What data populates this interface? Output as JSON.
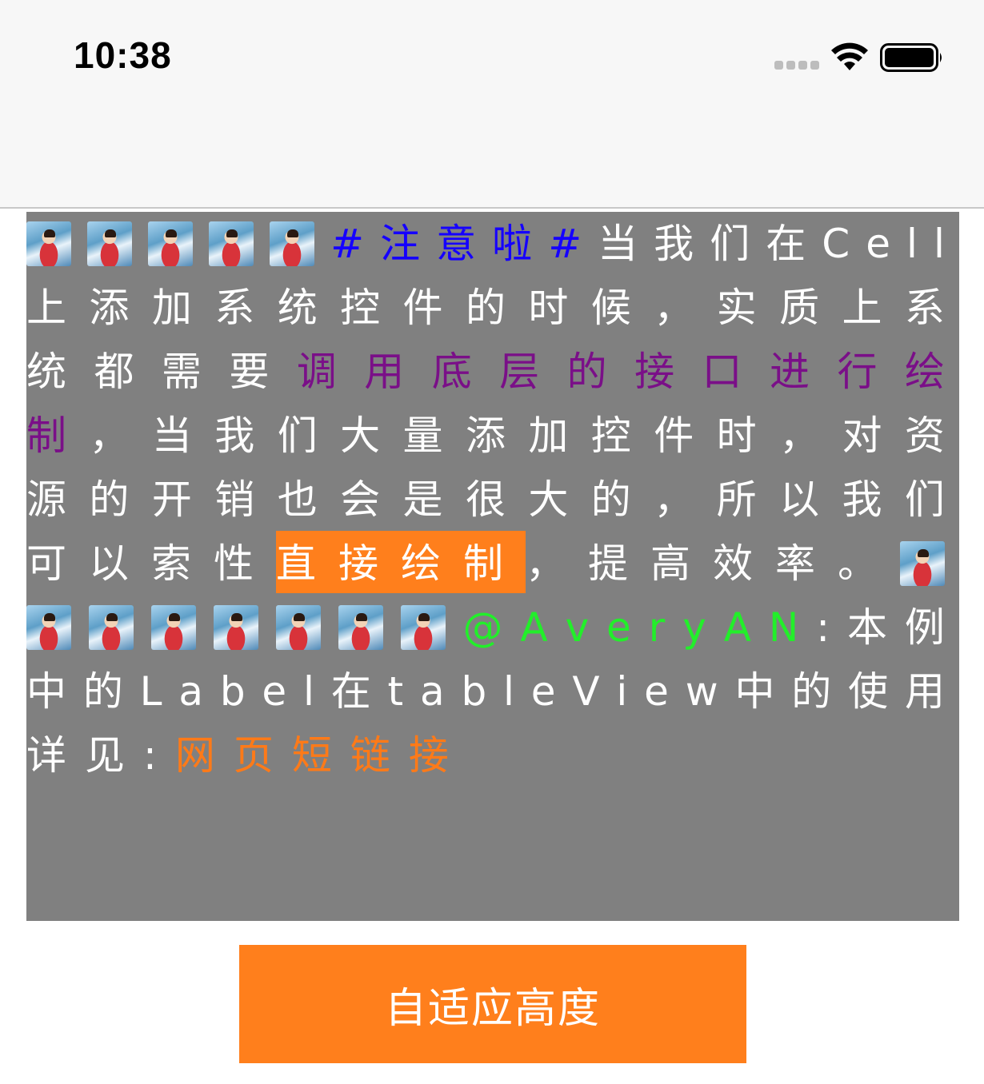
{
  "status_bar": {
    "time": "10:38"
  },
  "label": {
    "lines": [
      [
        "[emoji]",
        "[emoji]",
        "[emoji]",
        "[emoji]",
        "[emoji]",
        "#",
        "注",
        "意",
        "啦",
        "#",
        "当",
        "我",
        "们",
        "在",
        "C",
        "e",
        "l",
        "l"
      ],
      [
        "上",
        "添",
        "加",
        "系",
        "统",
        "控",
        "件",
        "的",
        "时",
        "候",
        "，",
        "实",
        "质",
        "上",
        "系"
      ],
      [
        "统",
        "都",
        "需",
        "要",
        "调",
        "用",
        "底",
        "层",
        "的",
        "接",
        "口",
        "进",
        "行",
        "绘"
      ],
      [
        "制",
        "，",
        "当",
        "我",
        "们",
        "大",
        "量",
        "添",
        "加",
        "控",
        "件",
        "时",
        "，",
        "对",
        "资"
      ],
      [
        "源",
        "的",
        "开",
        "销",
        "也",
        "会",
        "是",
        "很",
        "大",
        "的",
        "，",
        "所",
        "以",
        "我",
        "们"
      ],
      [
        "可",
        "以",
        "索",
        "性",
        "直",
        "接",
        "绘",
        "制",
        "，",
        "提",
        "高",
        "效",
        "率",
        "。",
        "[emoji]"
      ],
      [
        "[emoji]",
        "[emoji]",
        "[emoji]",
        "[emoji]",
        "[emoji]",
        "[emoji]",
        "[emoji]",
        "@",
        "A",
        "v",
        "e",
        "r",
        "y",
        "A",
        "N",
        ":",
        "本",
        "例"
      ],
      [
        "中",
        "的",
        "L",
        "a",
        "b",
        "e",
        "l",
        "在",
        "t",
        "a",
        "b",
        "l",
        "e",
        "V",
        "i",
        "e",
        "w",
        "中",
        "的",
        "使",
        "用"
      ],
      [
        "详",
        "见",
        ":",
        "网",
        "页",
        "短",
        "链",
        "接"
      ]
    ],
    "styles": {
      "0": {
        "5": "topic",
        "6": "topic",
        "7": "topic",
        "8": "topic",
        "9": "topic"
      },
      "2": {
        "4": "purple",
        "5": "purple",
        "6": "purple",
        "7": "purple",
        "8": "purple",
        "9": "purple",
        "10": "purple",
        "11": "purple",
        "12": "purple",
        "13": "purple"
      },
      "3": {
        "0": "purple"
      },
      "6": {
        "7": "green",
        "8": "green",
        "9": "green",
        "10": "green",
        "11": "green",
        "12": "green",
        "13": "green",
        "14": "green"
      },
      "8": {
        "3": "link",
        "4": "link",
        "5": "link",
        "6": "link",
        "7": "link"
      }
    }
  },
  "button": {
    "label": "自适应高度"
  }
}
